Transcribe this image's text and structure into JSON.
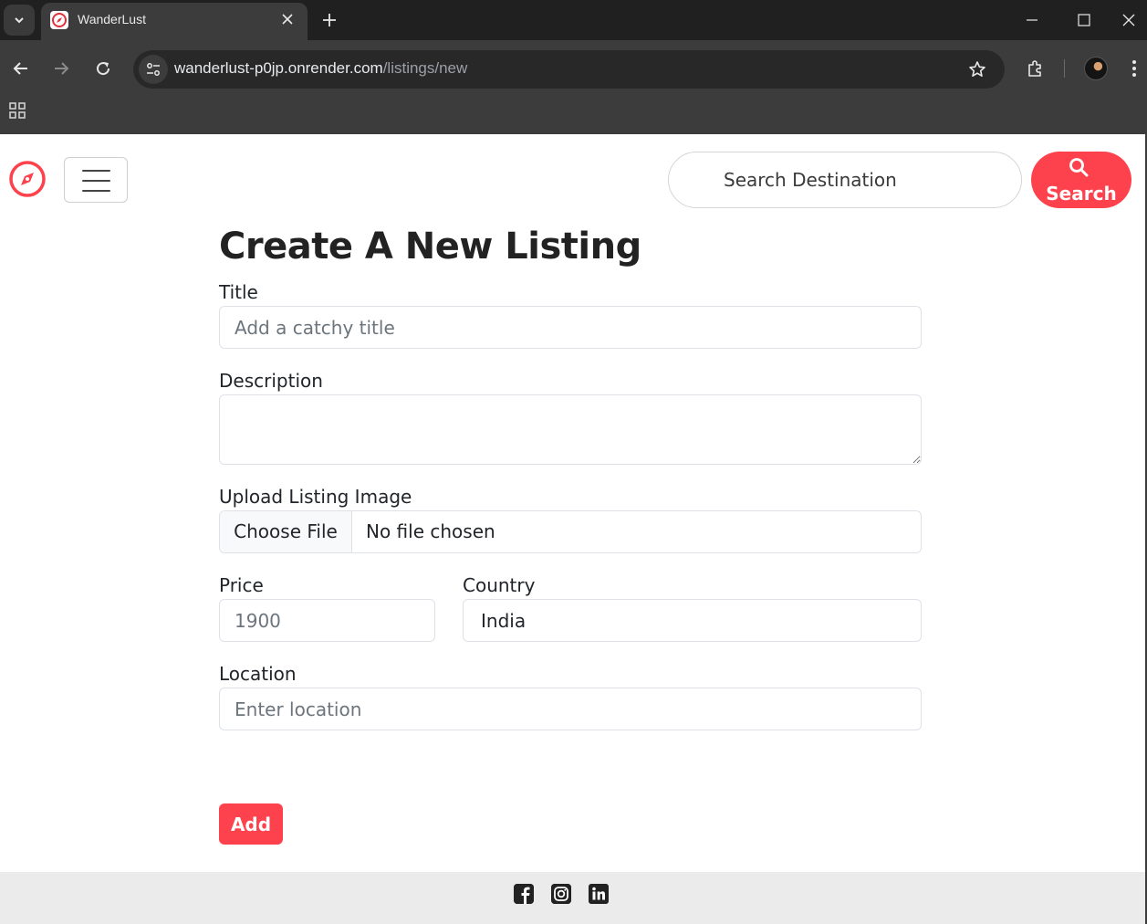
{
  "browser": {
    "tab_title": "WanderLust",
    "url_host": "wanderlust-p0jp.onrender.com",
    "url_path": "/listings/new",
    "icons": [
      "tab-search-icon",
      "close-icon",
      "plus-icon",
      "minimize-icon",
      "maximize-icon",
      "window-close-icon",
      "back-arrow-icon",
      "forward-arrow-icon",
      "reload-icon",
      "site-info-icon",
      "star-icon",
      "extensions-icon",
      "menu-dots-icon",
      "apps-grid-icon"
    ]
  },
  "navbar": {
    "brand_icon": "compass-icon",
    "search_placeholder": "Search Destination",
    "search_button_label": "Search",
    "accent_color": "#fe424d"
  },
  "form": {
    "heading": "Create A New Listing",
    "title_label": "Title",
    "title_placeholder": "Add a catchy title",
    "description_label": "Description",
    "description_value": "",
    "image_label": "Upload Listing Image",
    "choose_file_label": "Choose File",
    "file_status": "No file chosen",
    "price_label": "Price",
    "price_placeholder": "1900",
    "country_label": "Country",
    "country_value": "India",
    "location_label": "Location",
    "location_placeholder": "Enter location",
    "submit_label": "Add"
  },
  "footer": {
    "social_icons": [
      "facebook-icon",
      "instagram-icon",
      "linkedin-icon"
    ]
  }
}
